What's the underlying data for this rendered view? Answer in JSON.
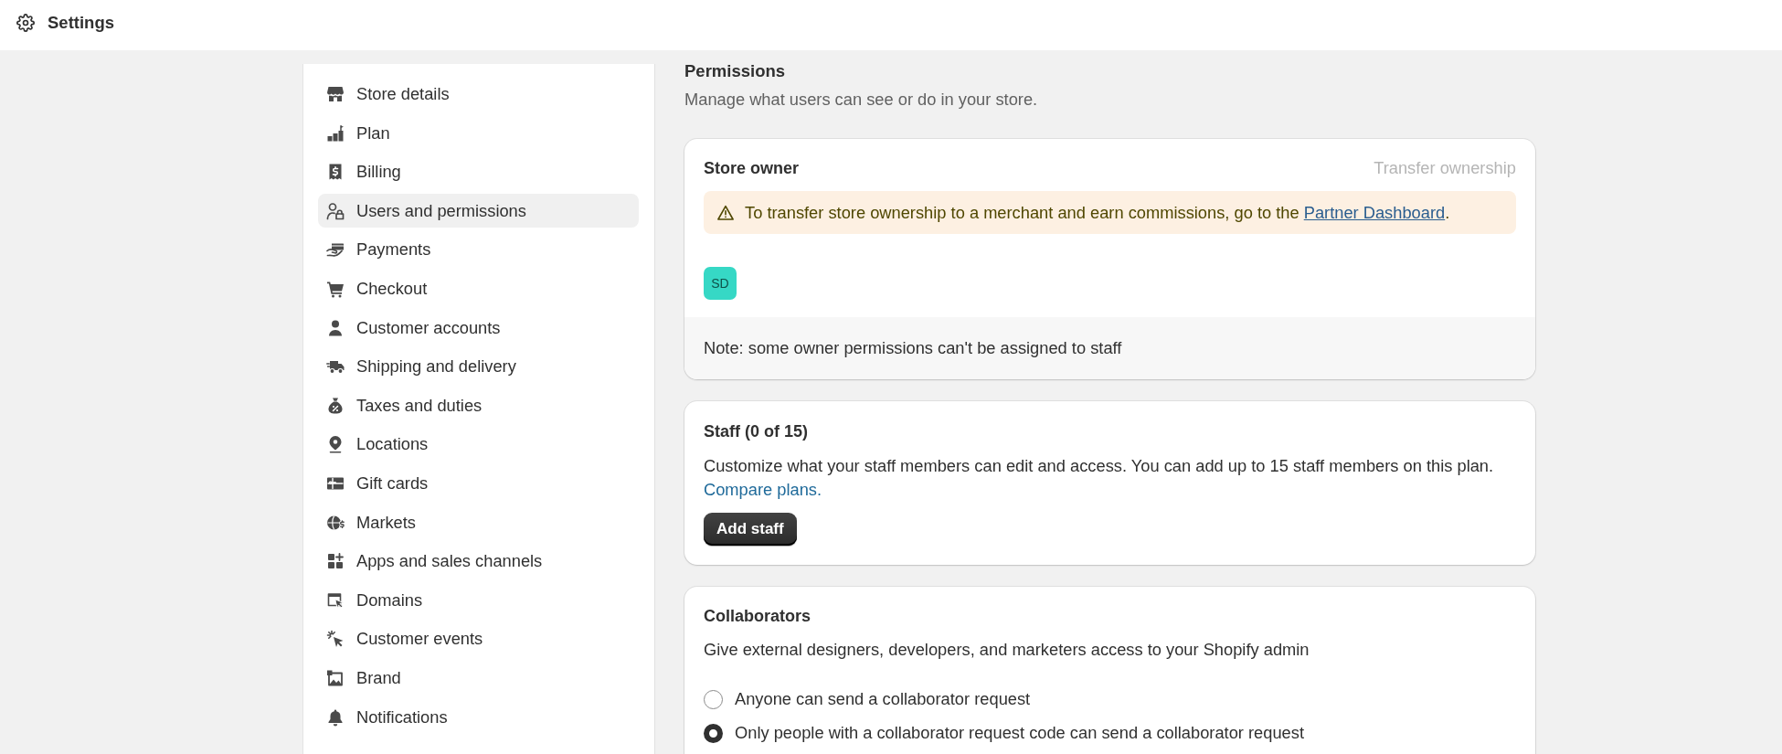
{
  "top_bar": {
    "title": "Settings"
  },
  "sidebar": {
    "items": [
      {
        "label": "Store details",
        "selected": false
      },
      {
        "label": "Plan",
        "selected": false
      },
      {
        "label": "Billing",
        "selected": false
      },
      {
        "label": "Users and permissions",
        "selected": true
      },
      {
        "label": "Payments",
        "selected": false
      },
      {
        "label": "Checkout",
        "selected": false
      },
      {
        "label": "Customer accounts",
        "selected": false
      },
      {
        "label": "Shipping and delivery",
        "selected": false
      },
      {
        "label": "Taxes and duties",
        "selected": false
      },
      {
        "label": "Locations",
        "selected": false
      },
      {
        "label": "Gift cards",
        "selected": false
      },
      {
        "label": "Markets",
        "selected": false
      },
      {
        "label": "Apps and sales channels",
        "selected": false
      },
      {
        "label": "Domains",
        "selected": false
      },
      {
        "label": "Customer events",
        "selected": false
      },
      {
        "label": "Brand",
        "selected": false
      },
      {
        "label": "Notifications",
        "selected": false
      }
    ]
  },
  "page": {
    "title": "Permissions",
    "subtitle": "Manage what users can see or do in your store."
  },
  "store_owner": {
    "title": "Store owner",
    "action": {
      "label": "Transfer ownership",
      "disabled": true
    },
    "banner": {
      "text": "To transfer store ownership to a merchant and earn commissions, go to the",
      "link": "Partner Dashboard",
      "text_after": "."
    },
    "avatar": {
      "initials": "SD"
    },
    "note": "Note: some owner permissions can't be assigned to staff"
  },
  "staff": {
    "title": "Staff (0 of 15)",
    "description": "Customize what your staff members can edit and access. You can add up to 15 staff members on this plan.",
    "link": "Compare plans.",
    "button": "Add staff"
  },
  "collaborators": {
    "title": "Collaborators",
    "description": "Give external designers, developers, and marketers access to your Shopify admin",
    "options": [
      {
        "label": "Anyone can send a collaborator request",
        "selected": false
      },
      {
        "label": "Only people with a collaborator request code can send a collaborator request",
        "selected": true
      }
    ]
  }
}
